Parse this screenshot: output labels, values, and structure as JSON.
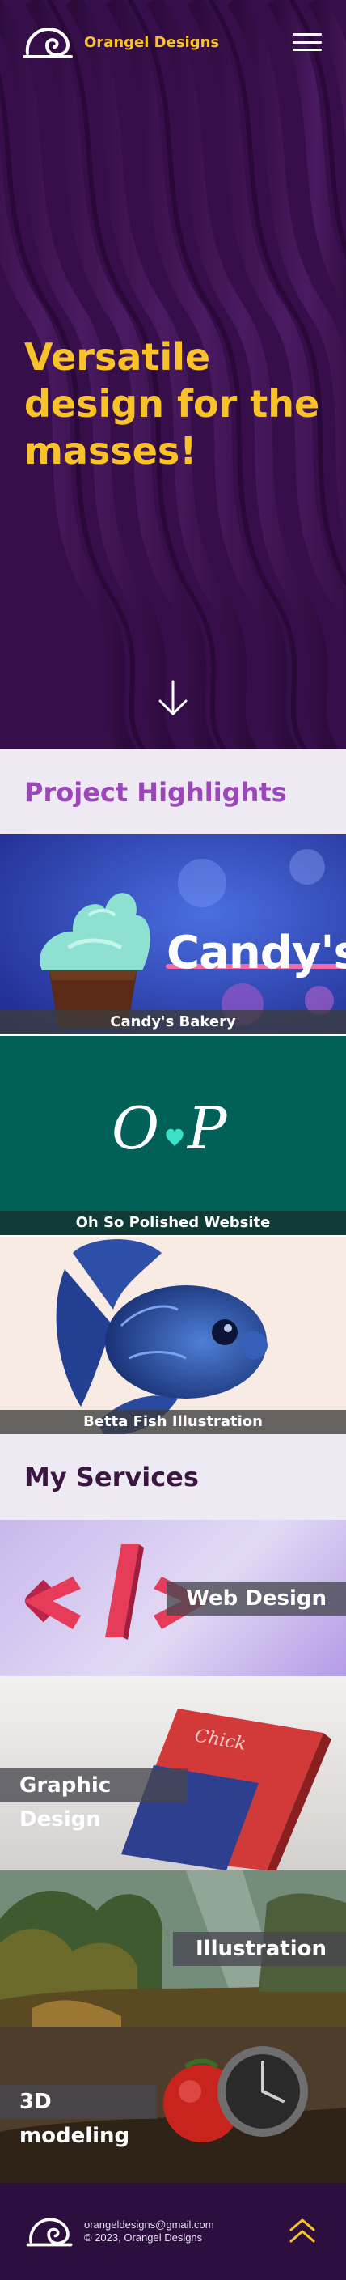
{
  "header": {
    "brand": "Orangel Designs",
    "logo_icon": "spiral-snail-logo-icon",
    "menu_icon": "hamburger-menu-icon"
  },
  "hero": {
    "title": "Versatile design for the masses!",
    "scroll_icon": "arrow-down-icon"
  },
  "projects": {
    "heading": "Project Highlights",
    "items": [
      {
        "caption": "Candy's Bakery",
        "image_text": "Candy's"
      },
      {
        "caption": "Oh So Polished Website",
        "logo_text_left": "O",
        "logo_text_right": "P"
      },
      {
        "caption": "Betta Fish Illustration"
      }
    ]
  },
  "services": {
    "heading": "My Services",
    "items": [
      {
        "label": "Web Design",
        "icon": "code-brackets-icon"
      },
      {
        "label": "Graphic Design",
        "icon": "book-cover-icon"
      },
      {
        "label": "Illustration",
        "icon": "landscape-icon"
      },
      {
        "label": "3D modeling",
        "icon": "tomato-clock-icon"
      }
    ]
  },
  "footer": {
    "email": "orangeldesigns@gmail.com",
    "copyright": "© 2023, Orangel Designs",
    "top_icon": "chevron-up-icon"
  },
  "colors": {
    "hero_bg": "#3b1151",
    "accent_yellow": "#f8c228",
    "projects_heading": "#9b46b9",
    "services_heading": "#3b1640",
    "footer_bg": "#2d0f3f"
  }
}
